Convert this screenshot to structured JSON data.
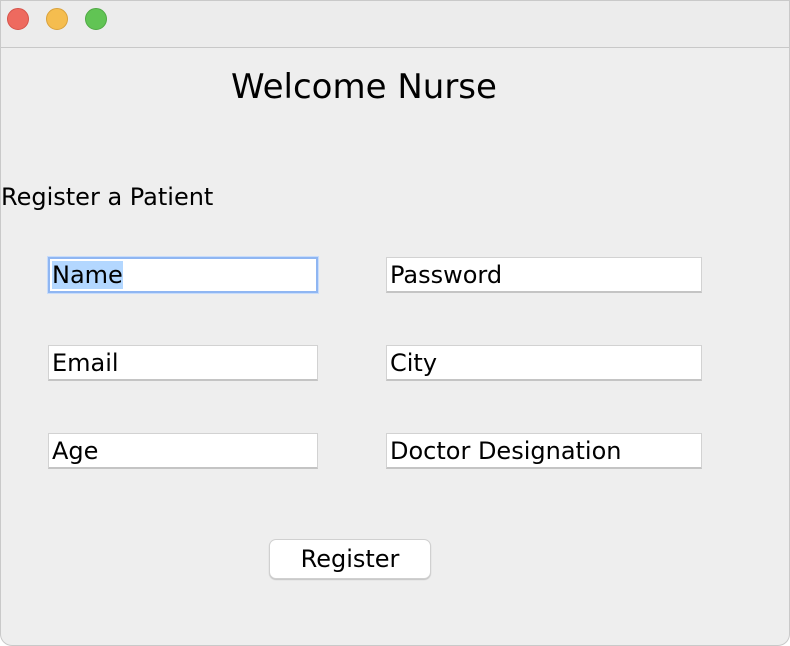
{
  "window": {
    "controls": {
      "close": "close-button",
      "minimize": "minimize-button",
      "zoom": "zoom-button"
    },
    "colors": {
      "close": "#ee6a5f",
      "minimize": "#f5bd4f",
      "zoom": "#61c454",
      "background": "#eeeeee",
      "selection": "#b3d7ff",
      "focus_ring": "#8fb6f2"
    }
  },
  "header": {
    "title": "Welcome Nurse"
  },
  "form": {
    "section_label": "Register a Patient",
    "fields": {
      "name": "Name",
      "password": "Password",
      "email": "Email",
      "city": "City",
      "age": "Age",
      "doctor_designation": "Doctor Designation"
    },
    "focused_field": "name",
    "submit_label": "Register"
  }
}
